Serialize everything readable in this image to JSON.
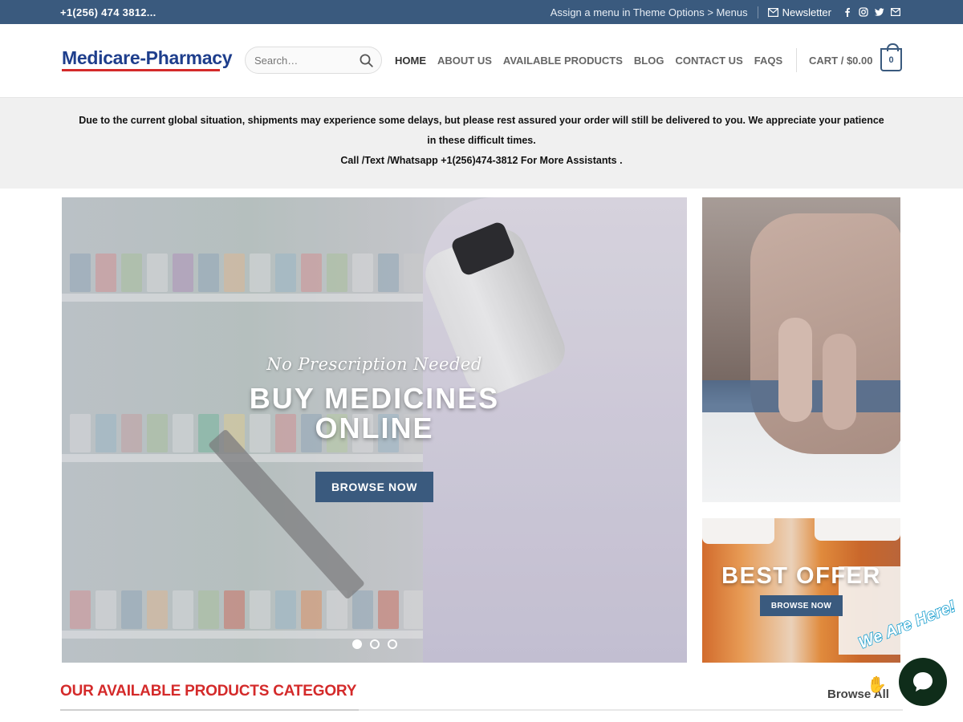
{
  "topbar": {
    "phone": "+1(256) 474 3812...",
    "menu_note": "Assign a menu in Theme Options > Menus",
    "newsletter": "Newsletter",
    "socials": [
      "facebook-icon",
      "instagram-icon",
      "twitter-icon",
      "email-icon"
    ]
  },
  "header": {
    "logo_text": "Medicare-Pharmacy",
    "search_placeholder": "Search…",
    "nav": [
      "HOME",
      "ABOUT US",
      "AVAILABLE PRODUCTS",
      "BLOG",
      "CONTACT US",
      "FAQS"
    ],
    "cart_label": "CART / $0.00",
    "cart_count": "0"
  },
  "notice": {
    "line1": "Due to the current global situation, shipments may experience some delays, but please rest assured your order will still be delivered to you. We appreciate your patience in these difficult times.",
    "line2": "Call /Text /Whatsapp +1(256)474-3812 For More Assistants ."
  },
  "hero": {
    "kicker": "No Prescription Needed",
    "headline_line1": "BUY MEDICINES",
    "headline_line2": "ONLINE",
    "cta": "BROWSE NOW",
    "slides": 3,
    "active_slide": 1
  },
  "side_banner": {
    "title": "BEST OFFER",
    "cta": "BROWSE NOW"
  },
  "section": {
    "title": "OUR AVAILABLE PRODUCTS CATEGORY",
    "browse_all": "Browse All"
  },
  "chat": {
    "label": "We Are Here!"
  },
  "colors": {
    "primary": "#3a5a7e",
    "accent_red": "#d42a2a",
    "chat_bg": "#0f2d1a"
  }
}
